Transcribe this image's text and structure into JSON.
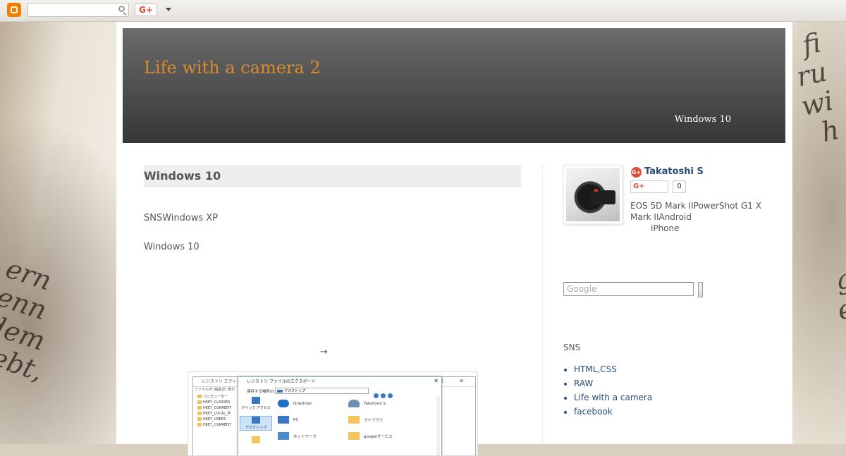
{
  "navbar": {
    "search_value": "",
    "gplus_label": "G+"
  },
  "header": {
    "title": "Life with a camera 2",
    "description": "Windows 10"
  },
  "post": {
    "title": "Windows 10",
    "paragraph1": "SNSWindows XP",
    "paragraph2": "Windows 10",
    "arrow": "→",
    "screenshot": {
      "reg_title": "レジストリ エディター",
      "reg_menu": "ファイル(F)  編集(E)  表示",
      "reg_tree": [
        "コンピューター",
        "HKEY_CLASSES",
        "HKEY_CURRENT",
        "HKEY_LOCAL_M",
        "HKEY_USERS",
        "HKEY_CURRENT"
      ],
      "export_title": "レジストリ ファイルのエクスポート",
      "save_location_label": "保存する場所(I):",
      "save_location_value": "デスクトップ",
      "side_items": [
        "クイック アクセス",
        "デスクトップ",
        ""
      ],
      "files": [
        [
          "OneDrive",
          "Takatoshi S"
        ],
        [
          "PC",
          "ライブラリ"
        ],
        [
          "ネットワーク",
          "googleサービス"
        ]
      ]
    }
  },
  "profile": {
    "badge": "G+",
    "name": "Takatoshi S",
    "follow_label": "G+",
    "follow_count": "0",
    "about_line1": "EOS 5D Mark IIPowerShot G1 X",
    "about_line2_left": "Mark II",
    "about_line2_right": "Android",
    "about_line3": "iPhone"
  },
  "search": {
    "placeholder": "Google"
  },
  "sns": {
    "title": "SNS",
    "links": [
      "HTML,CSS",
      "RAW",
      "Life with a camera",
      "facebook"
    ]
  }
}
